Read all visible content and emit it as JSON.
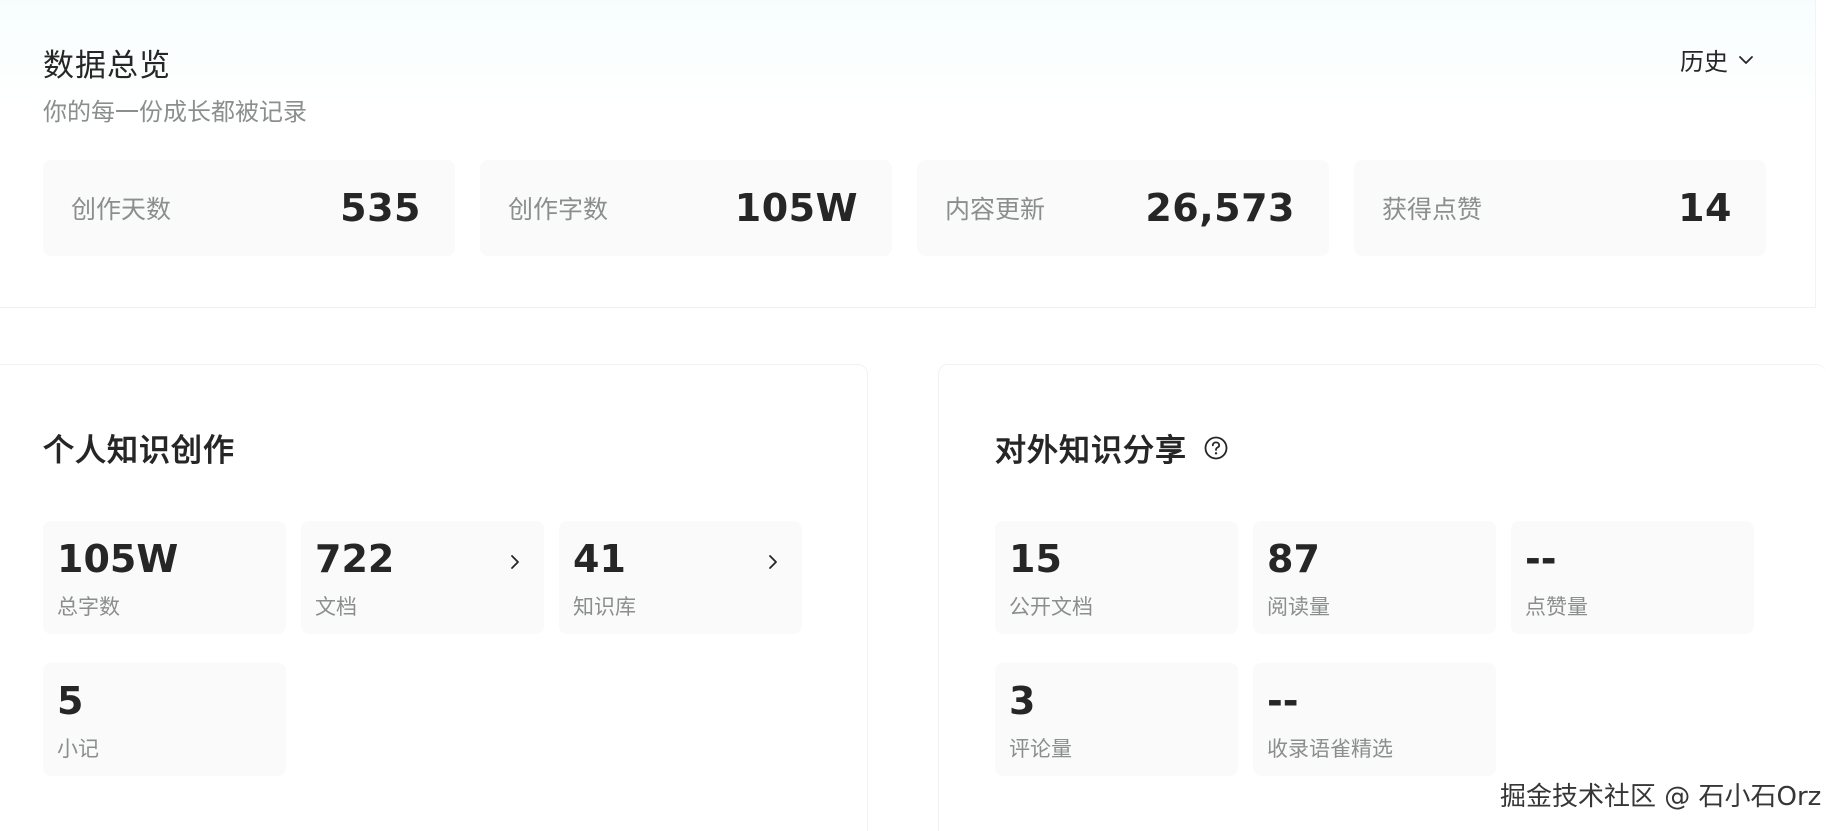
{
  "overview": {
    "title": "数据总览",
    "subtitle": "你的每一份成长都被记录",
    "history_label": "历史",
    "stats": [
      {
        "label": "创作天数",
        "value": "535"
      },
      {
        "label": "创作字数",
        "value": "105W"
      },
      {
        "label": "内容更新",
        "value": "26,573"
      },
      {
        "label": "获得点赞",
        "value": "14"
      }
    ]
  },
  "personal": {
    "title": "个人知识创作",
    "metrics": [
      {
        "value": "105W",
        "label": "总字数"
      },
      {
        "value": "722",
        "label": "文档"
      },
      {
        "value": "41",
        "label": "知识库"
      },
      {
        "value": "5",
        "label": "小记"
      }
    ]
  },
  "sharing": {
    "title": "对外知识分享",
    "metrics": [
      {
        "value": "15",
        "label": "公开文档"
      },
      {
        "value": "87",
        "label": "阅读量"
      },
      {
        "value": "--",
        "label": "点赞量"
      },
      {
        "value": "3",
        "label": "评论量"
      },
      {
        "value": "--",
        "label": "收录语雀精选"
      }
    ]
  },
  "watermark": "掘金技术社区 @ 石小石Orz",
  "icons": {
    "history_dropdown": "chevron-down-icon",
    "help": "question-circle-icon",
    "metric_link": "chevron-right-icon"
  },
  "colors": {
    "text_primary": "#262626",
    "text_secondary": "#8a8f8d",
    "card_background": "#fafafa"
  }
}
